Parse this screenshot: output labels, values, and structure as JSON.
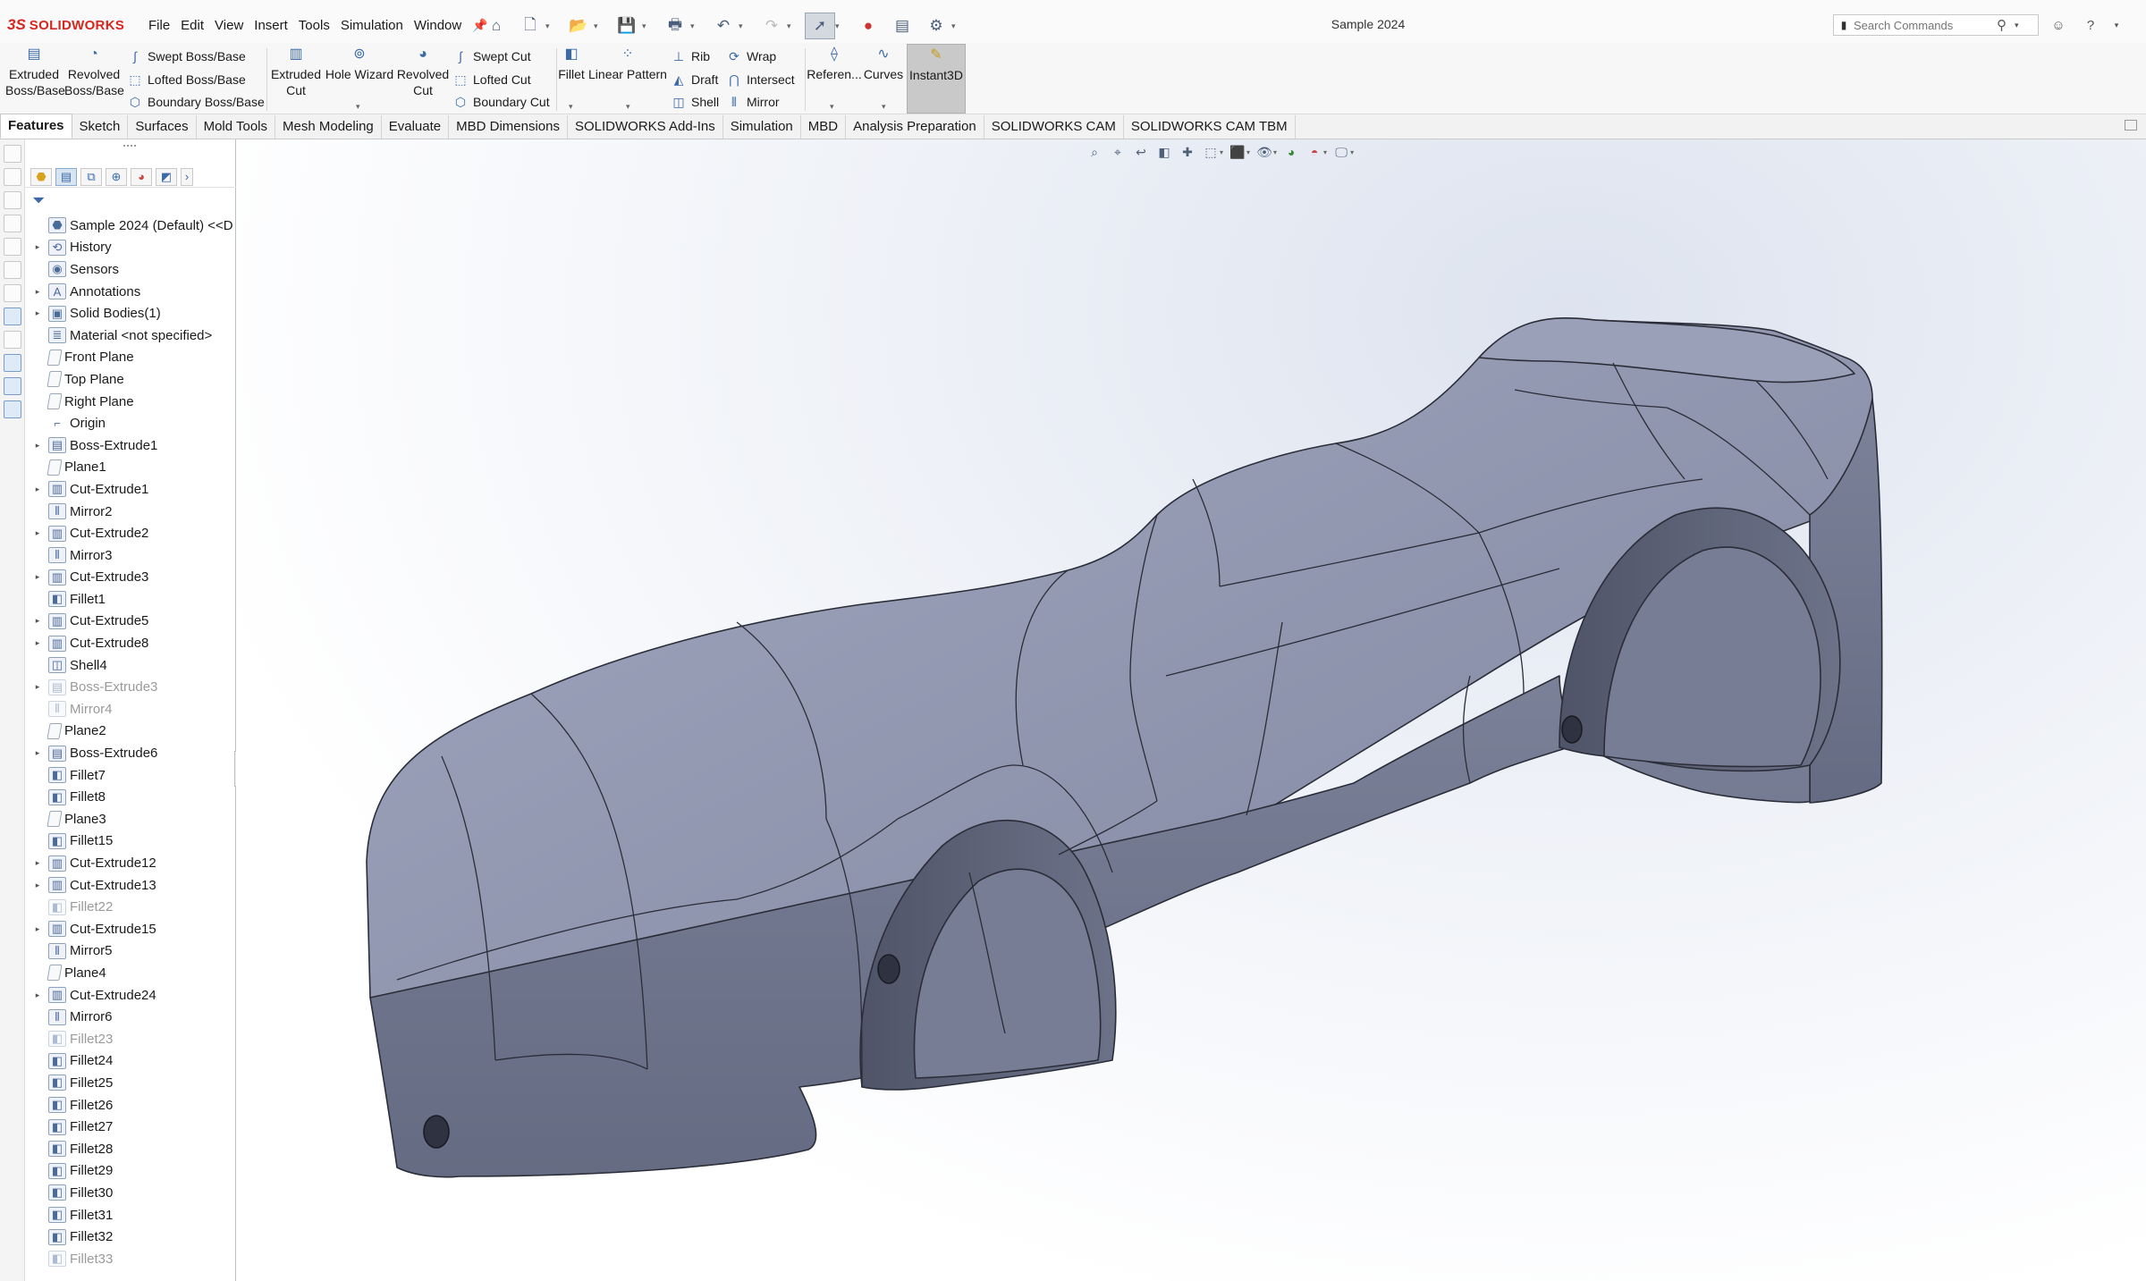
{
  "app": {
    "brand_mark": "3S",
    "brand_name": "SOLIDWORKS",
    "document_title": "Sample 2024"
  },
  "menus": [
    "File",
    "Edit",
    "View",
    "Insert",
    "Tools",
    "Simulation",
    "Window"
  ],
  "search": {
    "placeholder": "Search Commands"
  },
  "command_manager": {
    "extruded_boss": "Extruded\nBoss/Base",
    "revolved_boss": "Revolved\nBoss/Base",
    "swept_boss": "Swept Boss/Base",
    "lofted_boss": "Lofted Boss/Base",
    "boundary_boss": "Boundary Boss/Base",
    "extruded_cut": "Extruded\nCut",
    "hole_wizard": "Hole Wizard",
    "revolved_cut": "Revolved\nCut",
    "swept_cut": "Swept Cut",
    "lofted_cut": "Lofted Cut",
    "boundary_cut": "Boundary Cut",
    "fillet": "Fillet",
    "linear_pattern": "Linear Pattern",
    "rib": "Rib",
    "draft": "Draft",
    "shell": "Shell",
    "wrap": "Wrap",
    "intersect": "Intersect",
    "mirror": "Mirror",
    "reference": "Referen...",
    "curves": "Curves",
    "instant3d": "Instant3D"
  },
  "tabs": [
    {
      "label": "Features",
      "active": true
    },
    {
      "label": "Sketch"
    },
    {
      "label": "Surfaces"
    },
    {
      "label": "Mold Tools"
    },
    {
      "label": "Mesh Modeling"
    },
    {
      "label": "Evaluate"
    },
    {
      "label": "MBD Dimensions"
    },
    {
      "label": "SOLIDWORKS Add-Ins"
    },
    {
      "label": "Simulation"
    },
    {
      "label": "MBD"
    },
    {
      "label": "Analysis Preparation"
    },
    {
      "label": "SOLIDWORKS CAM"
    },
    {
      "label": "SOLIDWORKS CAM TBM"
    }
  ],
  "feature_tree": {
    "root": "Sample 2024 (Default) <<D",
    "items": [
      {
        "label": "History",
        "icon": "history-icon",
        "glyph": "⟲",
        "expandable": true
      },
      {
        "label": "Sensors",
        "icon": "sensor-icon",
        "glyph": "◉",
        "expandable": false
      },
      {
        "label": "Annotations",
        "icon": "annotation-icon",
        "glyph": "A",
        "expandable": true
      },
      {
        "label": "Solid Bodies(1)",
        "icon": "solid-bodies-icon",
        "glyph": "▣",
        "expandable": true
      },
      {
        "label": "Material <not specified>",
        "icon": "material-icon",
        "glyph": "≣",
        "expandable": false
      },
      {
        "label": "Front Plane",
        "icon": "plane-icon",
        "glyph": "",
        "plane": true
      },
      {
        "label": "Top Plane",
        "icon": "plane-icon",
        "glyph": "",
        "plane": true
      },
      {
        "label": "Right Plane",
        "icon": "plane-icon",
        "glyph": "",
        "plane": true
      },
      {
        "label": "Origin",
        "icon": "origin-icon",
        "glyph": "⌐",
        "none": true
      },
      {
        "label": "Boss-Extrude1",
        "icon": "boss-extrude-icon",
        "glyph": "▤",
        "expandable": true
      },
      {
        "label": "Plane1",
        "icon": "plane-icon",
        "glyph": "",
        "plane": true
      },
      {
        "label": "Cut-Extrude1",
        "icon": "cut-extrude-icon",
        "glyph": "▥",
        "expandable": true
      },
      {
        "label": "Mirror2",
        "icon": "mirror-icon",
        "glyph": "⫴"
      },
      {
        "label": "Cut-Extrude2",
        "icon": "cut-extrude-icon",
        "glyph": "▥",
        "expandable": true
      },
      {
        "label": "Mirror3",
        "icon": "mirror-icon",
        "glyph": "⫴"
      },
      {
        "label": "Cut-Extrude3",
        "icon": "cut-extrude-icon",
        "glyph": "▥",
        "expandable": true
      },
      {
        "label": "Fillet1",
        "icon": "fillet-icon",
        "glyph": "◧"
      },
      {
        "label": "Cut-Extrude5",
        "icon": "cut-extrude-icon",
        "glyph": "▥",
        "expandable": true
      },
      {
        "label": "Cut-Extrude8",
        "icon": "cut-extrude-icon",
        "glyph": "▥",
        "expandable": true
      },
      {
        "label": "Shell4",
        "icon": "shell-icon",
        "glyph": "◫"
      },
      {
        "label": "Boss-Extrude3",
        "icon": "boss-extrude-icon",
        "glyph": "▤",
        "expandable": true,
        "dim": true
      },
      {
        "label": "Mirror4",
        "icon": "mirror-icon",
        "glyph": "⫴",
        "dim": true
      },
      {
        "label": "Plane2",
        "icon": "plane-icon",
        "glyph": "",
        "plane": true
      },
      {
        "label": "Boss-Extrude6",
        "icon": "boss-extrude-icon",
        "glyph": "▤",
        "expandable": true
      },
      {
        "label": "Fillet7",
        "icon": "fillet-icon",
        "glyph": "◧"
      },
      {
        "label": "Fillet8",
        "icon": "fillet-icon",
        "glyph": "◧"
      },
      {
        "label": "Plane3",
        "icon": "plane-icon",
        "glyph": "",
        "plane": true
      },
      {
        "label": "Fillet15",
        "icon": "fillet-icon",
        "glyph": "◧"
      },
      {
        "label": "Cut-Extrude12",
        "icon": "cut-extrude-icon",
        "glyph": "▥",
        "expandable": true
      },
      {
        "label": "Cut-Extrude13",
        "icon": "cut-extrude-icon",
        "glyph": "▥",
        "expandable": true
      },
      {
        "label": "Fillet22",
        "icon": "fillet-icon",
        "glyph": "◧",
        "dim": true
      },
      {
        "label": "Cut-Extrude15",
        "icon": "cut-extrude-icon",
        "glyph": "▥",
        "expandable": true
      },
      {
        "label": "Mirror5",
        "icon": "mirror-icon",
        "glyph": "⫴"
      },
      {
        "label": "Plane4",
        "icon": "plane-icon",
        "glyph": "",
        "plane": true
      },
      {
        "label": "Cut-Extrude24",
        "icon": "cut-extrude-icon",
        "glyph": "▥",
        "expandable": true
      },
      {
        "label": "Mirror6",
        "icon": "mirror-icon",
        "glyph": "⫴"
      },
      {
        "label": "Fillet23",
        "icon": "fillet-icon",
        "glyph": "◧",
        "dim": true
      },
      {
        "label": "Fillet24",
        "icon": "fillet-icon",
        "glyph": "◧"
      },
      {
        "label": "Fillet25",
        "icon": "fillet-icon",
        "glyph": "◧"
      },
      {
        "label": "Fillet26",
        "icon": "fillet-icon",
        "glyph": "◧"
      },
      {
        "label": "Fillet27",
        "icon": "fillet-icon",
        "glyph": "◧"
      },
      {
        "label": "Fillet28",
        "icon": "fillet-icon",
        "glyph": "◧"
      },
      {
        "label": "Fillet29",
        "icon": "fillet-icon",
        "glyph": "◧"
      },
      {
        "label": "Fillet30",
        "icon": "fillet-icon",
        "glyph": "◧"
      },
      {
        "label": "Fillet31",
        "icon": "fillet-icon",
        "glyph": "◧"
      },
      {
        "label": "Fillet32",
        "icon": "fillet-icon",
        "glyph": "◧"
      },
      {
        "label": "Fillet33",
        "icon": "fillet-icon",
        "glyph": "◧",
        "dim": true
      }
    ]
  },
  "colors": {
    "brand_red": "#d7261e",
    "model_face": "#8f95ad",
    "model_shadow": "#5f657c",
    "model_edge": "#2a2d38",
    "accent_blue": "#3a6aa8"
  }
}
